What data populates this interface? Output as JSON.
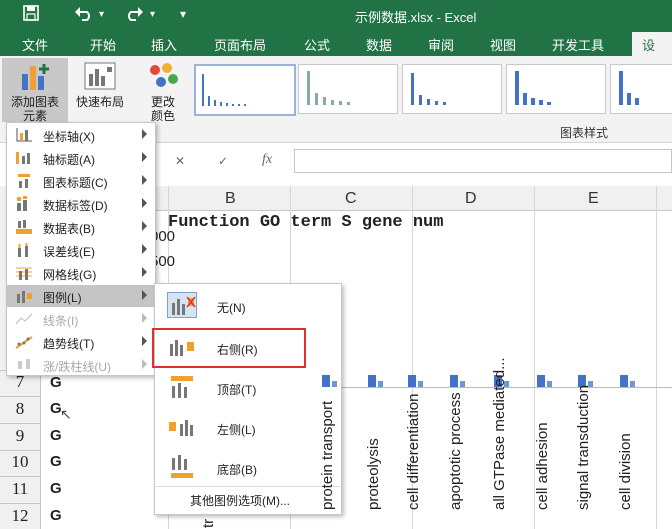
{
  "window": {
    "title": "示例数据.xlsx - Excel",
    "quick_access": [
      "save-icon",
      "undo-icon",
      "redo-icon",
      "customize-qat-icon"
    ]
  },
  "ribbon": {
    "tabs": [
      "文件",
      "开始",
      "插入",
      "页面布局",
      "公式",
      "数据",
      "审阅",
      "视图",
      "开发工具",
      "设计"
    ],
    "active_tab": "设计",
    "add_element": {
      "line1": "添加图表",
      "line2": "元素"
    },
    "quick_layout": "快速布局",
    "change_colors": {
      "line1": "更改",
      "line2": "颜色"
    },
    "gallery_label": "图表样式",
    "accent": "#217346"
  },
  "formula_bar": {
    "cancel": "✕",
    "enter": "✓",
    "fx": "fx"
  },
  "columns": [
    "B",
    "C",
    "D",
    "E"
  ],
  "header_row": "Function  GO term  S gene num",
  "axis_ticks": [
    "000",
    "500"
  ],
  "rows": [
    {
      "num": "7",
      "cell": "G"
    },
    {
      "num": "8",
      "cell": "G"
    },
    {
      "num": "9",
      "cell": "G"
    },
    {
      "num": "10",
      "cell": "G"
    },
    {
      "num": "11",
      "cell": "G"
    },
    {
      "num": "12",
      "cell": "G"
    }
  ],
  "chart_data": {
    "type": "bar",
    "categories": [
      "protein transport",
      "proteolysis",
      "cell differentiation",
      "apoptotic process",
      "all GTPase mediated...",
      "cell adhesion",
      "signal transduction",
      "cell division"
    ],
    "partial_label": "tr",
    "bar_color": "#4472c4"
  },
  "element_menu": {
    "items": [
      {
        "label": "坐标轴(X)",
        "icon": "axes-icon",
        "enabled": true
      },
      {
        "label": "轴标题(A)",
        "icon": "axis-title-icon",
        "enabled": true
      },
      {
        "label": "图表标题(C)",
        "icon": "chart-title-icon",
        "enabled": true
      },
      {
        "label": "数据标签(D)",
        "icon": "data-labels-icon",
        "enabled": true
      },
      {
        "label": "数据表(B)",
        "icon": "data-table-icon",
        "enabled": true
      },
      {
        "label": "误差线(E)",
        "icon": "error-bars-icon",
        "enabled": true
      },
      {
        "label": "网格线(G)",
        "icon": "gridlines-icon",
        "enabled": true
      },
      {
        "label": "图例(L)",
        "icon": "legend-icon",
        "enabled": true,
        "hover": true
      },
      {
        "label": "线条(I)",
        "icon": "lines-icon",
        "enabled": false
      },
      {
        "label": "趋势线(T)",
        "icon": "trendline-icon",
        "enabled": true
      },
      {
        "label": "涨/跌柱线(U)",
        "icon": "updown-bars-icon",
        "enabled": false
      }
    ]
  },
  "legend_submenu": {
    "items": [
      {
        "label": "无(N)",
        "icon": "legend-none-icon",
        "checked": true
      },
      {
        "label": "右侧(R)",
        "icon": "legend-right-icon",
        "highlighted": true
      },
      {
        "label": "顶部(T)",
        "icon": "legend-top-icon"
      },
      {
        "label": "左侧(L)",
        "icon": "legend-left-icon"
      },
      {
        "label": "底部(B)",
        "icon": "legend-bottom-icon"
      }
    ],
    "more": "其他图例选项(M)...",
    "highlight_color": "#e03030"
  }
}
